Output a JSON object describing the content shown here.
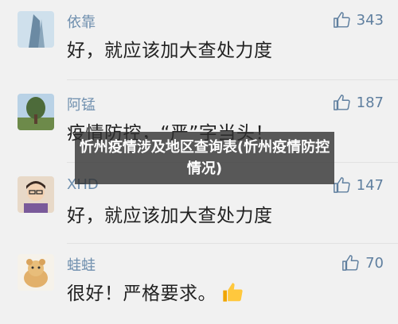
{
  "comments": [
    {
      "name": "依靠",
      "text": "好，就应该加大查处力度",
      "likes": "343",
      "avatar_icon": "building-avatar"
    },
    {
      "name": "阿锰",
      "text": "疫情防控，“严”字当头！",
      "likes": "187",
      "avatar_icon": "tree-avatar"
    },
    {
      "name": "XHD",
      "text": "好，就应该加大查处力度",
      "likes": "147",
      "avatar_icon": "cartoon-person-avatar"
    },
    {
      "name": "蛙蛙",
      "text": "很好！严格要求。",
      "likes": "70",
      "avatar_icon": "bear-avatar",
      "emoji": "thumbs-up"
    }
  ],
  "overlay": {
    "title": "忻州疫情涉及地区查询表(忻州疫情防控情况)"
  },
  "colors": {
    "name": "#6f8fae",
    "like": "#5f7f9f",
    "background": "#f1f1f1"
  }
}
